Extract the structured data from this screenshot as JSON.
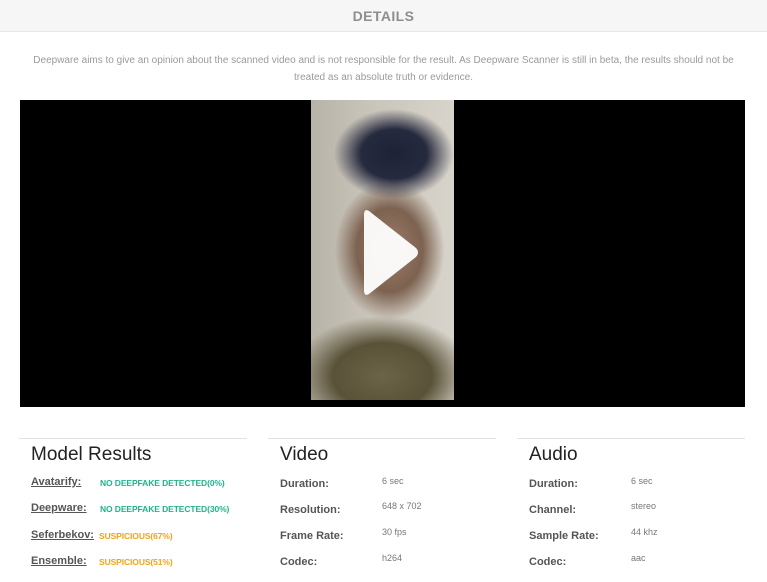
{
  "header": {
    "title": "DETAILS"
  },
  "disclaimer": "Deepware aims to give an opinion about the scanned video and is not responsible for the result. As Deepware Scanner is still in beta, the results should not be treated as an absolute truth or evidence.",
  "video": {
    "play_icon": "play-icon"
  },
  "colors": {
    "ok": "#1fb48b",
    "suspicious": "#f0a41c"
  },
  "model_results": {
    "title": "Model Results",
    "rows": [
      {
        "label": "Avatarify:",
        "result": "NO DEEPFAKE DETECTED(0%)",
        "status": "ok"
      },
      {
        "label": "Deepware:",
        "result": "NO DEEPFAKE DETECTED(30%)",
        "status": "ok"
      },
      {
        "label": "Seferbekov:",
        "result": "SUSPICIOUS(67%)",
        "status": "suspicious"
      },
      {
        "label": "Ensemble:",
        "result": "SUSPICIOUS(51%)",
        "status": "suspicious"
      }
    ]
  },
  "video_info": {
    "title": "Video",
    "rows": [
      {
        "label": "Duration:",
        "value": "6 sec"
      },
      {
        "label": "Resolution:",
        "value": "648 x 702"
      },
      {
        "label": "Frame Rate:",
        "value": "30 fps"
      },
      {
        "label": "Codec:",
        "value": "h264"
      }
    ]
  },
  "audio_info": {
    "title": "Audio",
    "rows": [
      {
        "label": "Duration:",
        "value": "6 sec"
      },
      {
        "label": "Channel:",
        "value": "stereo"
      },
      {
        "label": "Sample Rate:",
        "value": "44 khz"
      },
      {
        "label": "Codec:",
        "value": "aac"
      }
    ]
  }
}
